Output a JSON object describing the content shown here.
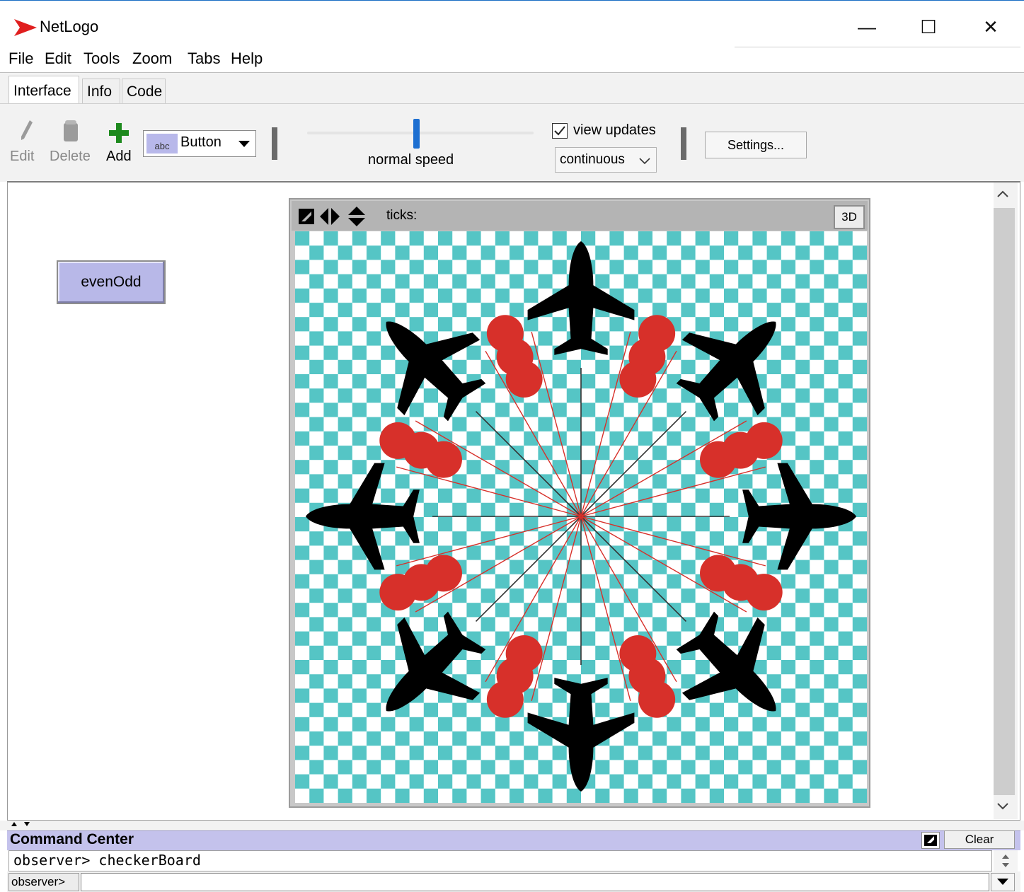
{
  "window": {
    "title": "NetLogo",
    "minimize": "—",
    "maximize": "☐",
    "close": "✕"
  },
  "menu": {
    "items": [
      "File",
      "Edit",
      "Tools",
      "Zoom",
      "Tabs",
      "Help"
    ]
  },
  "tabs": [
    {
      "label": "Interface",
      "active": true
    },
    {
      "label": "Info"
    },
    {
      "label": "Code"
    }
  ],
  "toolbar": {
    "edit_label": "Edit",
    "delete_label": "Delete",
    "add_label": "Add",
    "widget_type": "Button",
    "widget_icon_text": "abc",
    "speed_label": "normal speed",
    "speed_level_percent": 48,
    "view_updates_label": "view updates",
    "view_updates_checked": true,
    "update_mode": "continuous",
    "settings_label": "Settings..."
  },
  "workspace": {
    "buttons": [
      {
        "label": "evenOdd"
      }
    ],
    "view": {
      "ticks_label": "ticks:",
      "btn_3d": "3D"
    }
  },
  "colors": {
    "checker": "#55c5c5",
    "red_turtle": "#d7302a",
    "airplane": "#000000",
    "button_bg": "#b8b8e8",
    "cc_header": "#c4c2ec",
    "speed_thumb": "#1d6fd1"
  },
  "command_center": {
    "title": "Command Center",
    "clear_label": "Clear",
    "output": "observer> checkerBoard",
    "prompt": "observer>",
    "input_value": ""
  }
}
